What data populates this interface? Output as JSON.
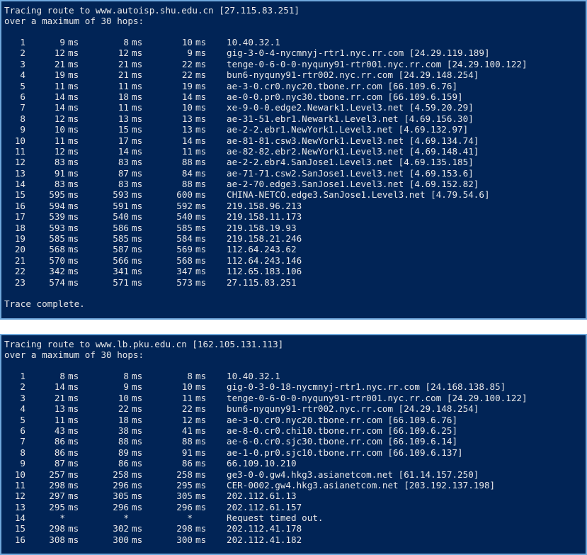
{
  "trace1": {
    "header_line1": "Tracing route to www.autoisp.shu.edu.cn [27.115.83.251]",
    "header_line2": "over a maximum of 30 hops:",
    "footer": "Trace complete.",
    "hops": [
      {
        "hop": "1",
        "t1": "9",
        "u1": "ms",
        "t2": "8",
        "u2": "ms",
        "t3": "10",
        "u3": "ms",
        "host": "10.40.32.1"
      },
      {
        "hop": "2",
        "t1": "12",
        "u1": "ms",
        "t2": "12",
        "u2": "ms",
        "t3": "9",
        "u3": "ms",
        "host": "gig-3-0-4-nycmnyj-rtr1.nyc.rr.com [24.29.119.189]"
      },
      {
        "hop": "3",
        "t1": "21",
        "u1": "ms",
        "t2": "21",
        "u2": "ms",
        "t3": "22",
        "u3": "ms",
        "host": "tenge-0-6-0-0-nyquny91-rtr001.nyc.rr.com [24.29.100.122]"
      },
      {
        "hop": "4",
        "t1": "19",
        "u1": "ms",
        "t2": "21",
        "u2": "ms",
        "t3": "22",
        "u3": "ms",
        "host": "bun6-nyquny91-rtr002.nyc.rr.com [24.29.148.254]"
      },
      {
        "hop": "5",
        "t1": "11",
        "u1": "ms",
        "t2": "11",
        "u2": "ms",
        "t3": "19",
        "u3": "ms",
        "host": "ae-3-0.cr0.nyc20.tbone.rr.com [66.109.6.76]"
      },
      {
        "hop": "6",
        "t1": "14",
        "u1": "ms",
        "t2": "18",
        "u2": "ms",
        "t3": "14",
        "u3": "ms",
        "host": "ae-0-0.pr0.nyc30.tbone.rr.com [66.109.6.159]"
      },
      {
        "hop": "7",
        "t1": "14",
        "u1": "ms",
        "t2": "11",
        "u2": "ms",
        "t3": "10",
        "u3": "ms",
        "host": "xe-9-0-0.edge2.Newark1.Level3.net [4.59.20.29]"
      },
      {
        "hop": "8",
        "t1": "12",
        "u1": "ms",
        "t2": "13",
        "u2": "ms",
        "t3": "13",
        "u3": "ms",
        "host": "ae-31-51.ebr1.Newark1.Level3.net [4.69.156.30]"
      },
      {
        "hop": "9",
        "t1": "10",
        "u1": "ms",
        "t2": "15",
        "u2": "ms",
        "t3": "13",
        "u3": "ms",
        "host": "ae-2-2.ebr1.NewYork1.Level3.net [4.69.132.97]"
      },
      {
        "hop": "10",
        "t1": "11",
        "u1": "ms",
        "t2": "17",
        "u2": "ms",
        "t3": "14",
        "u3": "ms",
        "host": "ae-81-81.csw3.NewYork1.Level3.net [4.69.134.74]"
      },
      {
        "hop": "11",
        "t1": "12",
        "u1": "ms",
        "t2": "14",
        "u2": "ms",
        "t3": "11",
        "u3": "ms",
        "host": "ae-82-82.ebr2.NewYork1.Level3.net [4.69.148.41]"
      },
      {
        "hop": "12",
        "t1": "83",
        "u1": "ms",
        "t2": "83",
        "u2": "ms",
        "t3": "88",
        "u3": "ms",
        "host": "ae-2-2.ebr4.SanJose1.Level3.net [4.69.135.185]"
      },
      {
        "hop": "13",
        "t1": "91",
        "u1": "ms",
        "t2": "87",
        "u2": "ms",
        "t3": "84",
        "u3": "ms",
        "host": "ae-71-71.csw2.SanJose1.Level3.net [4.69.153.6]"
      },
      {
        "hop": "14",
        "t1": "83",
        "u1": "ms",
        "t2": "83",
        "u2": "ms",
        "t3": "88",
        "u3": "ms",
        "host": "ae-2-70.edge3.SanJose1.Level3.net [4.69.152.82]"
      },
      {
        "hop": "15",
        "t1": "595",
        "u1": "ms",
        "t2": "593",
        "u2": "ms",
        "t3": "600",
        "u3": "ms",
        "host": "CHINA-NETCO.edge3.SanJose1.Level3.net [4.79.54.6]"
      },
      {
        "hop": "16",
        "t1": "594",
        "u1": "ms",
        "t2": "591",
        "u2": "ms",
        "t3": "592",
        "u3": "ms",
        "host": "219.158.96.213"
      },
      {
        "hop": "17",
        "t1": "539",
        "u1": "ms",
        "t2": "540",
        "u2": "ms",
        "t3": "540",
        "u3": "ms",
        "host": "219.158.11.173"
      },
      {
        "hop": "18",
        "t1": "593",
        "u1": "ms",
        "t2": "586",
        "u2": "ms",
        "t3": "585",
        "u3": "ms",
        "host": "219.158.19.93"
      },
      {
        "hop": "19",
        "t1": "585",
        "u1": "ms",
        "t2": "585",
        "u2": "ms",
        "t3": "584",
        "u3": "ms",
        "host": "219.158.21.246"
      },
      {
        "hop": "20",
        "t1": "568",
        "u1": "ms",
        "t2": "587",
        "u2": "ms",
        "t3": "569",
        "u3": "ms",
        "host": "112.64.243.62"
      },
      {
        "hop": "21",
        "t1": "570",
        "u1": "ms",
        "t2": "566",
        "u2": "ms",
        "t3": "568",
        "u3": "ms",
        "host": "112.64.243.146"
      },
      {
        "hop": "22",
        "t1": "342",
        "u1": "ms",
        "t2": "341",
        "u2": "ms",
        "t3": "347",
        "u3": "ms",
        "host": "112.65.183.106"
      },
      {
        "hop": "23",
        "t1": "574",
        "u1": "ms",
        "t2": "571",
        "u2": "ms",
        "t3": "573",
        "u3": "ms",
        "host": "27.115.83.251"
      }
    ]
  },
  "trace2": {
    "header_line1": "Tracing route to www.lb.pku.edu.cn [162.105.131.113]",
    "header_line2": "over a maximum of 30 hops:",
    "hops": [
      {
        "hop": "1",
        "t1": "8",
        "u1": "ms",
        "t2": "8",
        "u2": "ms",
        "t3": "8",
        "u3": "ms",
        "host": "10.40.32.1"
      },
      {
        "hop": "2",
        "t1": "14",
        "u1": "ms",
        "t2": "9",
        "u2": "ms",
        "t3": "10",
        "u3": "ms",
        "host": "gig-0-3-0-18-nycmnyj-rtr1.nyc.rr.com [24.168.138.85]"
      },
      {
        "hop": "3",
        "t1": "21",
        "u1": "ms",
        "t2": "10",
        "u2": "ms",
        "t3": "11",
        "u3": "ms",
        "host": "tenge-0-6-0-0-nyquny91-rtr001.nyc.rr.com [24.29.100.122]"
      },
      {
        "hop": "4",
        "t1": "13",
        "u1": "ms",
        "t2": "22",
        "u2": "ms",
        "t3": "22",
        "u3": "ms",
        "host": "bun6-nyquny91-rtr002.nyc.rr.com [24.29.148.254]"
      },
      {
        "hop": "5",
        "t1": "11",
        "u1": "ms",
        "t2": "18",
        "u2": "ms",
        "t3": "12",
        "u3": "ms",
        "host": "ae-3-0.cr0.nyc20.tbone.rr.com [66.109.6.76]"
      },
      {
        "hop": "6",
        "t1": "43",
        "u1": "ms",
        "t2": "38",
        "u2": "ms",
        "t3": "41",
        "u3": "ms",
        "host": "ae-8-0.cr0.chi10.tbone.rr.com [66.109.6.25]"
      },
      {
        "hop": "7",
        "t1": "86",
        "u1": "ms",
        "t2": "88",
        "u2": "ms",
        "t3": "88",
        "u3": "ms",
        "host": "ae-6-0.cr0.sjc30.tbone.rr.com [66.109.6.14]"
      },
      {
        "hop": "8",
        "t1": "86",
        "u1": "ms",
        "t2": "89",
        "u2": "ms",
        "t3": "91",
        "u3": "ms",
        "host": "ae-1-0.pr0.sjc10.tbone.rr.com [66.109.6.137]"
      },
      {
        "hop": "9",
        "t1": "87",
        "u1": "ms",
        "t2": "86",
        "u2": "ms",
        "t3": "86",
        "u3": "ms",
        "host": "66.109.10.210"
      },
      {
        "hop": "10",
        "t1": "257",
        "u1": "ms",
        "t2": "258",
        "u2": "ms",
        "t3": "258",
        "u3": "ms",
        "host": "ge3-0-0.gw4.hkg3.asianetcom.net [61.14.157.250]"
      },
      {
        "hop": "11",
        "t1": "298",
        "u1": "ms",
        "t2": "296",
        "u2": "ms",
        "t3": "295",
        "u3": "ms",
        "host": "CER-0002.gw4.hkg3.asianetcom.net [203.192.137.198]"
      },
      {
        "hop": "12",
        "t1": "297",
        "u1": "ms",
        "t2": "305",
        "u2": "ms",
        "t3": "305",
        "u3": "ms",
        "host": "202.112.61.13"
      },
      {
        "hop": "13",
        "t1": "295",
        "u1": "ms",
        "t2": "296",
        "u2": "ms",
        "t3": "296",
        "u3": "ms",
        "host": "202.112.61.157"
      },
      {
        "hop": "14",
        "t1": "*",
        "u1": "",
        "t2": "*",
        "u2": "",
        "t3": "*",
        "u3": "",
        "host": "Request timed out."
      },
      {
        "hop": "15",
        "t1": "298",
        "u1": "ms",
        "t2": "302",
        "u2": "ms",
        "t3": "298",
        "u3": "ms",
        "host": "202.112.41.178"
      },
      {
        "hop": "16",
        "t1": "308",
        "u1": "ms",
        "t2": "300",
        "u2": "ms",
        "t3": "300",
        "u3": "ms",
        "host": "202.112.41.182"
      }
    ]
  }
}
